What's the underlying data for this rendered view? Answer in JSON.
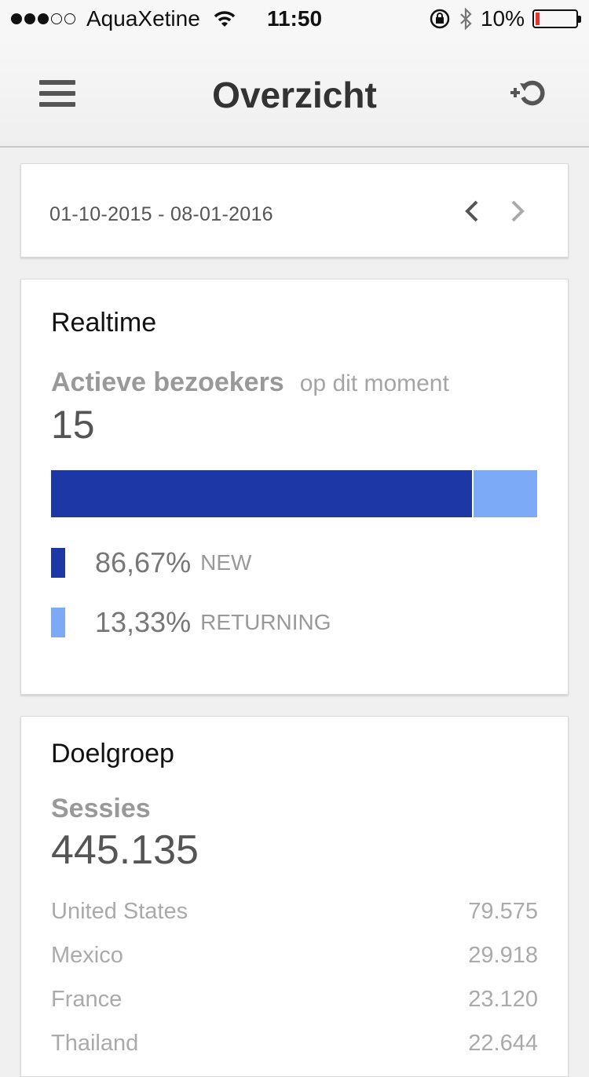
{
  "status_bar": {
    "carrier": "AquaXetine",
    "time": "11:50",
    "battery": "10%"
  },
  "nav": {
    "title": "Overzicht"
  },
  "date_range": {
    "text": "01-10-2015 - 08-01-2016"
  },
  "realtime": {
    "title": "Realtime",
    "metric_label": "Actieve bezoekers",
    "metric_sub": "op dit moment",
    "value": "15",
    "new": {
      "pct": "86,67%",
      "label": "NEW",
      "fraction": 0.8667,
      "color": "#1d37a7"
    },
    "returning": {
      "pct": "13,33%",
      "label": "RETURNING",
      "fraction": 0.1333,
      "color": "#7caaf6"
    }
  },
  "doelgroep": {
    "title": "Doelgroep",
    "metric_label": "Sessies",
    "value": "445.135",
    "countries": [
      {
        "name": "United States",
        "value": "79.575"
      },
      {
        "name": "Mexico",
        "value": "29.918"
      },
      {
        "name": "France",
        "value": "23.120"
      },
      {
        "name": "Thailand",
        "value": "22.644"
      }
    ]
  },
  "icons": {
    "menu": "hamburger-menu-icon",
    "refresh": "refresh-add-icon",
    "prev": "chevron-left-icon",
    "next": "chevron-right-icon"
  }
}
